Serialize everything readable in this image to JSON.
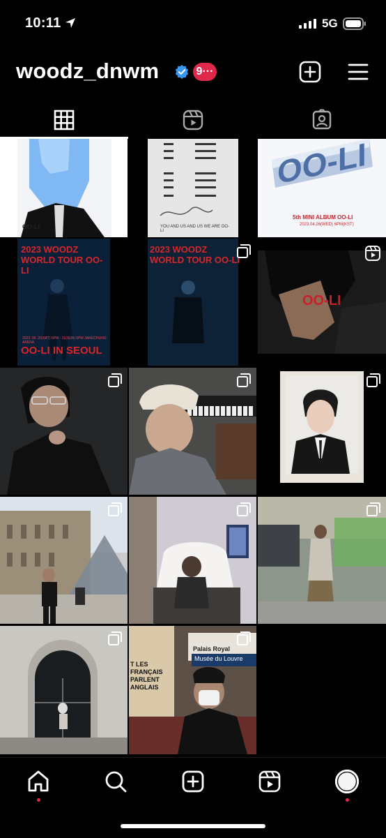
{
  "status_bar": {
    "time": "10:11",
    "network": "5G"
  },
  "profile": {
    "username": "woodz_dnwm",
    "notification_count": "9···",
    "verified": true
  },
  "header_icons": [
    "plus-square-icon",
    "menu-icon"
  ],
  "tabs": [
    {
      "name": "posts-grid",
      "icon": "grid-icon",
      "active": true
    },
    {
      "name": "reels",
      "icon": "reels-icon",
      "active": false
    },
    {
      "name": "tagged",
      "icon": "tagged-icon",
      "active": false
    }
  ],
  "posts": [
    {
      "caption": "OO-LI"
    },
    {
      "caption": "YOU AND US AND US WE ARE OO-LI"
    },
    {
      "caption": "OO-LI",
      "subcaption": "5th MINI ALBUM OO-LI",
      "small": "2023.04.26(WED) 6PM(KST)"
    },
    {
      "title": "2023 WOODZ WORLD TOUR OO-LI",
      "footer": "OO-LI IN SEOUL",
      "date": "2023. 05. 20(SAT) 6PM - 21(SUN) 5PM JANGCHUNG ARENA"
    },
    {
      "title": "2023 WOODZ WORLD TOUR OO-LI"
    },
    {
      "caption": "OO-LI"
    },
    {},
    {},
    {},
    {},
    {},
    {},
    {},
    {
      "sign_1": "Palais Royal",
      "sign_2": "Musée du Louvre",
      "poster": "T LES FRANÇAIS PARLENT ANGLAIS"
    }
  ],
  "colors": {
    "background": "#000000",
    "notification": "#e0284a",
    "verified": "#3897f0",
    "poster_red": "#d8262a"
  },
  "bottom_nav": [
    "home-icon",
    "search-icon",
    "create-icon",
    "reels-icon",
    "profile-avatar"
  ]
}
